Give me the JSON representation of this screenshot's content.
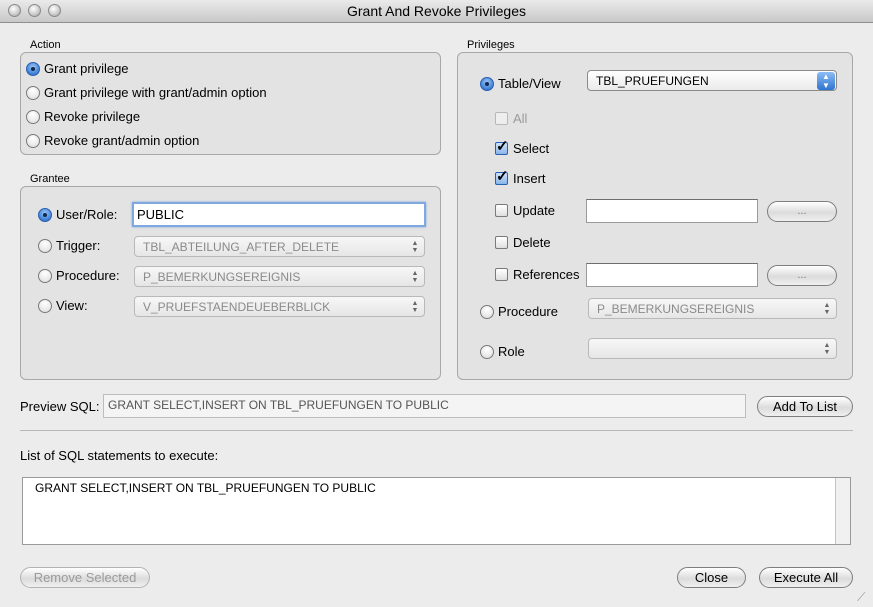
{
  "window": {
    "title": "Grant And Revoke Privileges"
  },
  "action": {
    "label": "Action",
    "options": [
      {
        "label": "Grant privilege",
        "selected": true
      },
      {
        "label": "Grant privilege with grant/admin option",
        "selected": false
      },
      {
        "label": "Revoke privilege",
        "selected": false
      },
      {
        "label": "Revoke grant/admin option",
        "selected": false
      }
    ]
  },
  "grantee": {
    "label": "Grantee",
    "user_role": {
      "label": "User/Role:",
      "value": "PUBLIC",
      "selected": true
    },
    "trigger": {
      "label": "Trigger:",
      "value": "TBL_ABTEILUNG_AFTER_DELETE"
    },
    "procedure": {
      "label": "Procedure:",
      "value": "P_BEMERKUNGSEREIGNIS"
    },
    "view": {
      "label": "View:",
      "value": "V_PRUEFSTAENDEUEBERBLICK"
    }
  },
  "privileges": {
    "label": "Privileges",
    "table_view": {
      "label": "Table/View",
      "value": "TBL_PRUEFUNGEN",
      "selected": true
    },
    "checks": {
      "all": {
        "label": "All",
        "checked": false,
        "enabled": false
      },
      "select": {
        "label": "Select",
        "checked": true
      },
      "insert": {
        "label": "Insert",
        "checked": true
      },
      "update": {
        "label": "Update",
        "checked": false,
        "button": "..."
      },
      "delete": {
        "label": "Delete",
        "checked": false
      },
      "references": {
        "label": "References",
        "checked": false,
        "button": "..."
      }
    },
    "procedure": {
      "label": "Procedure",
      "value": "P_BEMERKUNGSEREIGNIS"
    },
    "role": {
      "label": "Role",
      "value": ""
    }
  },
  "preview": {
    "label": "Preview SQL:",
    "value": "GRANT SELECT,INSERT ON TBL_PRUEFUNGEN TO PUBLIC",
    "add_button": "Add To List"
  },
  "list": {
    "label": "List of SQL statements to execute:",
    "items": [
      "GRANT SELECT,INSERT ON TBL_PRUEFUNGEN TO PUBLIC"
    ]
  },
  "footer": {
    "remove_selected": "Remove Selected",
    "close": "Close",
    "execute_all": "Execute All"
  },
  "colors": {
    "accent": "#3d7fd6",
    "window_bg": "#ececec",
    "group_bg": "#e3e3e3"
  }
}
